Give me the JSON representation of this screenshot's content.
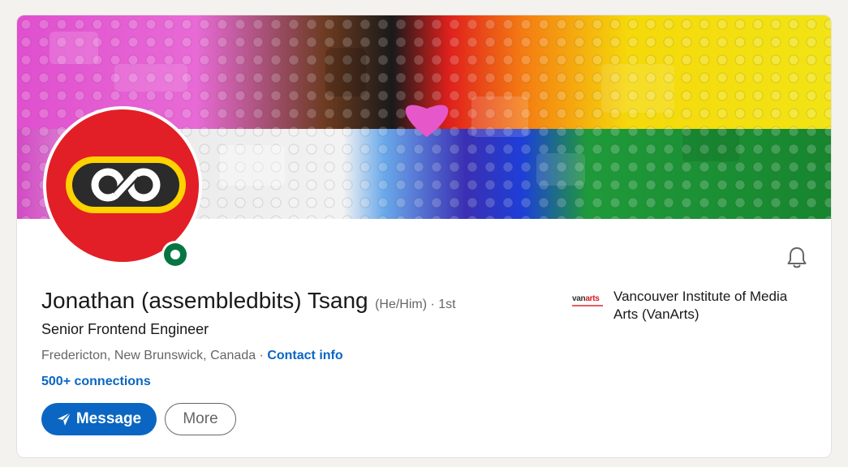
{
  "colors": {
    "accent": "#0a66c2",
    "online": "#057642",
    "avatar_bg": "#e21f26",
    "text_primary": "#191919",
    "text_secondary": "#666666"
  },
  "cover": {
    "icon": "lego-rainbow-cover-image"
  },
  "profile": {
    "avatar_icon": "infinity-logo-avatar",
    "online_status_icon": "online-status-dot",
    "name": "Jonathan (assembledbits) Tsang",
    "pronouns": "(He/Him)",
    "degree": " · 1st",
    "headline": "Senior Frontend Engineer",
    "location": "Fredericton, New Brunswick, Canada",
    "location_separator": " · ",
    "contact_info": "Contact info",
    "connections": "500+ connections"
  },
  "actions": {
    "message_label": "Message",
    "more_label": "More",
    "bell_icon": "bell-icon",
    "send_icon": "send-icon"
  },
  "education": {
    "logo_text_a": "van",
    "logo_text_b": "arts",
    "name": "Vancouver Institute of Media Arts (VanArts)"
  }
}
